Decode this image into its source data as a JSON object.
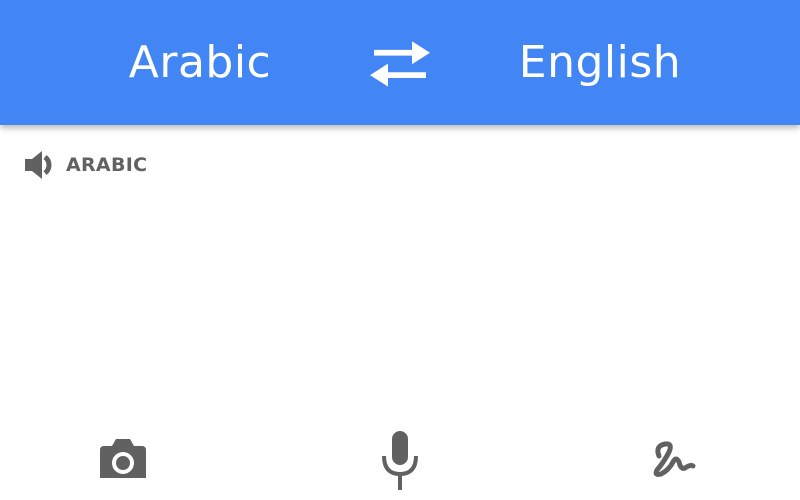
{
  "header": {
    "source_language": "Arabic",
    "target_language": "English",
    "swap_icon": "swap-arrows-icon"
  },
  "source": {
    "label": "ARABIC",
    "speaker_icon": "speaker-icon"
  },
  "tools": {
    "camera_icon": "camera-icon",
    "mic_icon": "microphone-icon",
    "handwrite_icon": "handwriting-icon"
  },
  "colors": {
    "accent": "#4285f4",
    "icon_gray": "#616161",
    "background": "#ffffff"
  }
}
